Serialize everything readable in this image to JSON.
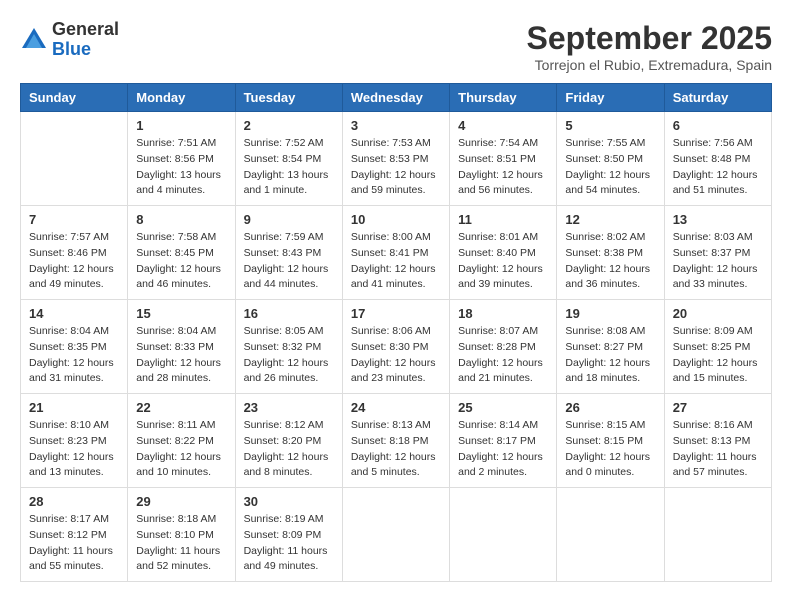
{
  "header": {
    "logo_line1": "General",
    "logo_line2": "Blue",
    "month_title": "September 2025",
    "location": "Torrejon el Rubio, Extremadura, Spain"
  },
  "days_of_week": [
    "Sunday",
    "Monday",
    "Tuesday",
    "Wednesday",
    "Thursday",
    "Friday",
    "Saturday"
  ],
  "weeks": [
    [
      {
        "day": "",
        "info": ""
      },
      {
        "day": "1",
        "info": "Sunrise: 7:51 AM\nSunset: 8:56 PM\nDaylight: 13 hours\nand 4 minutes."
      },
      {
        "day": "2",
        "info": "Sunrise: 7:52 AM\nSunset: 8:54 PM\nDaylight: 13 hours\nand 1 minute."
      },
      {
        "day": "3",
        "info": "Sunrise: 7:53 AM\nSunset: 8:53 PM\nDaylight: 12 hours\nand 59 minutes."
      },
      {
        "day": "4",
        "info": "Sunrise: 7:54 AM\nSunset: 8:51 PM\nDaylight: 12 hours\nand 56 minutes."
      },
      {
        "day": "5",
        "info": "Sunrise: 7:55 AM\nSunset: 8:50 PM\nDaylight: 12 hours\nand 54 minutes."
      },
      {
        "day": "6",
        "info": "Sunrise: 7:56 AM\nSunset: 8:48 PM\nDaylight: 12 hours\nand 51 minutes."
      }
    ],
    [
      {
        "day": "7",
        "info": "Sunrise: 7:57 AM\nSunset: 8:46 PM\nDaylight: 12 hours\nand 49 minutes."
      },
      {
        "day": "8",
        "info": "Sunrise: 7:58 AM\nSunset: 8:45 PM\nDaylight: 12 hours\nand 46 minutes."
      },
      {
        "day": "9",
        "info": "Sunrise: 7:59 AM\nSunset: 8:43 PM\nDaylight: 12 hours\nand 44 minutes."
      },
      {
        "day": "10",
        "info": "Sunrise: 8:00 AM\nSunset: 8:41 PM\nDaylight: 12 hours\nand 41 minutes."
      },
      {
        "day": "11",
        "info": "Sunrise: 8:01 AM\nSunset: 8:40 PM\nDaylight: 12 hours\nand 39 minutes."
      },
      {
        "day": "12",
        "info": "Sunrise: 8:02 AM\nSunset: 8:38 PM\nDaylight: 12 hours\nand 36 minutes."
      },
      {
        "day": "13",
        "info": "Sunrise: 8:03 AM\nSunset: 8:37 PM\nDaylight: 12 hours\nand 33 minutes."
      }
    ],
    [
      {
        "day": "14",
        "info": "Sunrise: 8:04 AM\nSunset: 8:35 PM\nDaylight: 12 hours\nand 31 minutes."
      },
      {
        "day": "15",
        "info": "Sunrise: 8:04 AM\nSunset: 8:33 PM\nDaylight: 12 hours\nand 28 minutes."
      },
      {
        "day": "16",
        "info": "Sunrise: 8:05 AM\nSunset: 8:32 PM\nDaylight: 12 hours\nand 26 minutes."
      },
      {
        "day": "17",
        "info": "Sunrise: 8:06 AM\nSunset: 8:30 PM\nDaylight: 12 hours\nand 23 minutes."
      },
      {
        "day": "18",
        "info": "Sunrise: 8:07 AM\nSunset: 8:28 PM\nDaylight: 12 hours\nand 21 minutes."
      },
      {
        "day": "19",
        "info": "Sunrise: 8:08 AM\nSunset: 8:27 PM\nDaylight: 12 hours\nand 18 minutes."
      },
      {
        "day": "20",
        "info": "Sunrise: 8:09 AM\nSunset: 8:25 PM\nDaylight: 12 hours\nand 15 minutes."
      }
    ],
    [
      {
        "day": "21",
        "info": "Sunrise: 8:10 AM\nSunset: 8:23 PM\nDaylight: 12 hours\nand 13 minutes."
      },
      {
        "day": "22",
        "info": "Sunrise: 8:11 AM\nSunset: 8:22 PM\nDaylight: 12 hours\nand 10 minutes."
      },
      {
        "day": "23",
        "info": "Sunrise: 8:12 AM\nSunset: 8:20 PM\nDaylight: 12 hours\nand 8 minutes."
      },
      {
        "day": "24",
        "info": "Sunrise: 8:13 AM\nSunset: 8:18 PM\nDaylight: 12 hours\nand 5 minutes."
      },
      {
        "day": "25",
        "info": "Sunrise: 8:14 AM\nSunset: 8:17 PM\nDaylight: 12 hours\nand 2 minutes."
      },
      {
        "day": "26",
        "info": "Sunrise: 8:15 AM\nSunset: 8:15 PM\nDaylight: 12 hours\nand 0 minutes."
      },
      {
        "day": "27",
        "info": "Sunrise: 8:16 AM\nSunset: 8:13 PM\nDaylight: 11 hours\nand 57 minutes."
      }
    ],
    [
      {
        "day": "28",
        "info": "Sunrise: 8:17 AM\nSunset: 8:12 PM\nDaylight: 11 hours\nand 55 minutes."
      },
      {
        "day": "29",
        "info": "Sunrise: 8:18 AM\nSunset: 8:10 PM\nDaylight: 11 hours\nand 52 minutes."
      },
      {
        "day": "30",
        "info": "Sunrise: 8:19 AM\nSunset: 8:09 PM\nDaylight: 11 hours\nand 49 minutes."
      },
      {
        "day": "",
        "info": ""
      },
      {
        "day": "",
        "info": ""
      },
      {
        "day": "",
        "info": ""
      },
      {
        "day": "",
        "info": ""
      }
    ]
  ]
}
